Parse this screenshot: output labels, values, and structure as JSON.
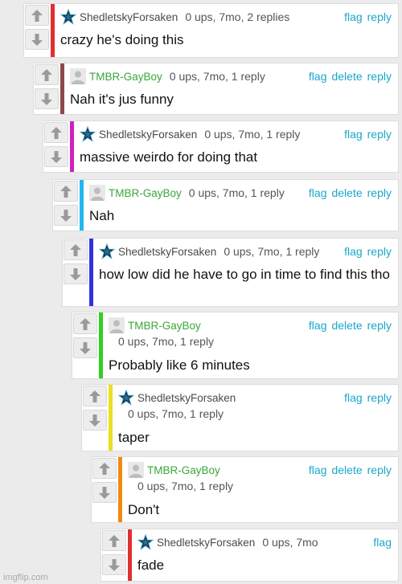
{
  "comments": [
    {
      "user": "ShedletskyForsaken",
      "meta": "0 ups, 7mo, 2 replies",
      "text": "crazy he's doing this",
      "flag": "flag",
      "delete": "",
      "reply": "reply",
      "color": "#e03030",
      "user_color": "blue",
      "avatar": "star-icon"
    },
    {
      "user": "TMBR-GayBoy",
      "meta": "0 ups, 7mo, 1 reply",
      "text": "Nah it's jus funny",
      "flag": "flag",
      "delete": "delete",
      "reply": "reply",
      "color": "#8b4a4a",
      "user_color": "green",
      "avatar": "default-avatar-icon"
    },
    {
      "user": "ShedletskyForsaken",
      "meta": "0 ups, 7mo, 1 reply",
      "text": "massive weirdo for doing that",
      "flag": "flag",
      "delete": "",
      "reply": "reply",
      "color": "#d020c0",
      "user_color": "blue",
      "avatar": "star-icon"
    },
    {
      "user": "TMBR-GayBoy",
      "meta": "0 ups, 7mo, 1 reply",
      "text": "Nah",
      "flag": "flag",
      "delete": "delete",
      "reply": "reply",
      "color": "#20b8f0",
      "user_color": "green",
      "avatar": "default-avatar-icon"
    },
    {
      "user": "ShedletskyForsaken",
      "meta": "0 ups, 7mo, 1 reply",
      "text": "how low did he have to go in time to find this tho",
      "flag": "flag",
      "delete": "",
      "reply": "reply",
      "color": "#3030e0",
      "user_color": "blue",
      "avatar": "star-icon"
    },
    {
      "user": "TMBR-GayBoy",
      "meta": "0 ups, 7mo, 1 reply",
      "text": "Probably like 6 minutes",
      "flag": "flag",
      "delete": "delete",
      "reply": "reply",
      "color": "#30d020",
      "user_color": "green",
      "avatar": "default-avatar-icon"
    },
    {
      "user": "ShedletskyForsaken",
      "meta": "0 ups, 7mo, 1 reply",
      "text": "taper",
      "flag": "flag",
      "delete": "",
      "reply": "reply",
      "color": "#e8e020",
      "user_color": "blue",
      "avatar": "star-icon"
    },
    {
      "user": "TMBR-GayBoy",
      "meta": "0 ups, 7mo, 1 reply",
      "text": "Don't",
      "flag": "flag",
      "delete": "delete",
      "reply": "reply",
      "color": "#f08a10",
      "user_color": "green",
      "avatar": "default-avatar-icon"
    },
    {
      "user": "ShedletskyForsaken",
      "meta": "0 ups, 7mo",
      "text": "fade",
      "flag": "flag",
      "delete": "",
      "reply": "",
      "color": "#e03030",
      "user_color": "blue",
      "avatar": "star-icon"
    }
  ],
  "watermark": "imgflip.com"
}
